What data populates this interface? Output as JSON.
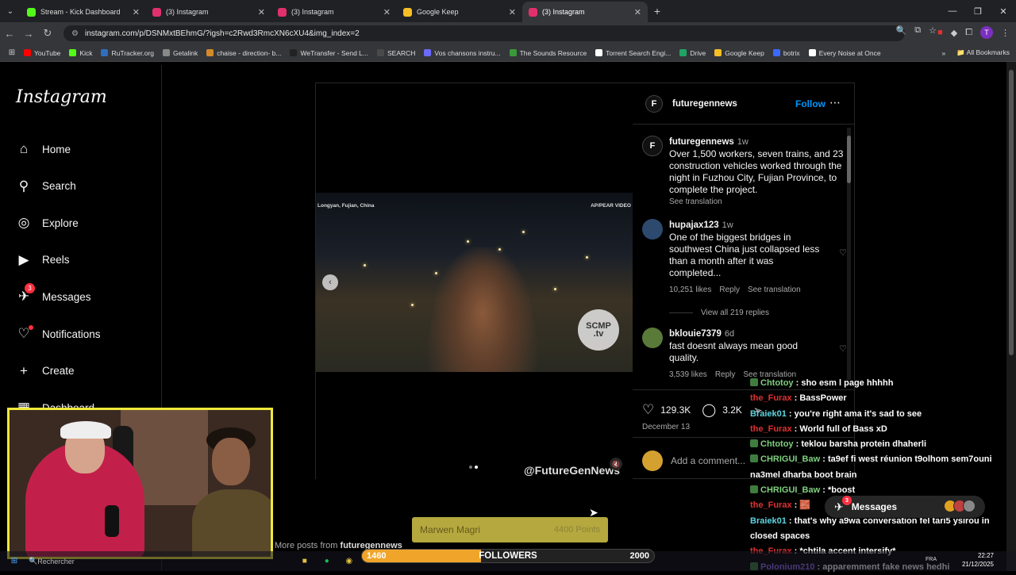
{
  "browser": {
    "tabs": [
      {
        "title": "Stream - Kick Dashboard",
        "color": "#53fc18",
        "active": false
      },
      {
        "title": "(3) Instagram",
        "color": "#e1306c",
        "active": false
      },
      {
        "title": "(3) Instagram",
        "color": "#e1306c",
        "active": false
      },
      {
        "title": "Google Keep",
        "color": "#f6bf26",
        "active": false
      },
      {
        "title": "(3) Instagram",
        "color": "#e1306c",
        "active": true
      }
    ],
    "url": "instagram.com/p/DSNMxtBEhmG/?igsh=c2Rwd3RmcXN6cXU4&img_index=2",
    "profile_initial": "T",
    "bookmarks": [
      {
        "label": "YouTube",
        "color": "#ff0000"
      },
      {
        "label": "Kick",
        "color": "#53fc18"
      },
      {
        "label": "RuTracker.org",
        "color": "#2f6fbf"
      },
      {
        "label": "Getalink",
        "color": "#888888"
      },
      {
        "label": "chaise - direction- b...",
        "color": "#d48a2a"
      },
      {
        "label": "WeTransfer - Send L...",
        "color": "#222222"
      },
      {
        "label": "SEARCH",
        "color": "#4a4a4a"
      },
      {
        "label": "Vos chansons instru...",
        "color": "#6a6aff"
      },
      {
        "label": "The Sounds Resource",
        "color": "#3a9a3a"
      },
      {
        "label": "Torrent Search Engi...",
        "color": "#ffffff"
      },
      {
        "label": "Drive",
        "color": "#1fa463"
      },
      {
        "label": "Google Keep",
        "color": "#f6bf26"
      },
      {
        "label": "botrix",
        "color": "#3a6aff"
      },
      {
        "label": "Every Noise at Once",
        "color": "#ffffff"
      }
    ],
    "all_bookmarks": "All Bookmarks"
  },
  "instagram": {
    "logo": "Instagram",
    "nav": [
      {
        "label": "Home",
        "icon": "home-icon"
      },
      {
        "label": "Search",
        "icon": "search-icon"
      },
      {
        "label": "Explore",
        "icon": "compass-icon"
      },
      {
        "label": "Reels",
        "icon": "reels-icon"
      },
      {
        "label": "Messages",
        "icon": "messenger-icon",
        "badge": "3"
      },
      {
        "label": "Notifications",
        "icon": "heart-icon"
      },
      {
        "label": "Create",
        "icon": "plus-icon"
      },
      {
        "label": "Dashboard",
        "icon": "dashboard-icon"
      }
    ],
    "post": {
      "author": "futuregennews",
      "follow": "Follow",
      "video_label_left": "Longyan, Fujian, China",
      "video_label_right": "AP/PEAR VIDEO",
      "scmp_line1": "SCMP",
      "scmp_line2": ".tv",
      "watermark": "@FutureGenNews",
      "caption": {
        "user": "futuregennews",
        "time": "1w",
        "text": "Over 1,500 workers, seven trains, and 23 construction vehicles worked through the night in Fuzhou City, Fujian Province, to complete the project.",
        "see_translation": "See translation"
      },
      "comments": [
        {
          "user": "hupajax123",
          "time": "1w",
          "text": "One of the biggest bridges in southwest China just collapsed less than a month after it was completed...",
          "likes": "10,251 likes",
          "reply": "Reply",
          "translate": "See translation",
          "view_replies": "View all 219 replies"
        },
        {
          "user": "bklouie7379",
          "time": "6d",
          "text": "fast doesnt always mean good quality.",
          "likes": "3,539 likes",
          "reply": "Reply",
          "translate": "See translation"
        }
      ],
      "like_count": "129.3K",
      "comment_count": "3.2K",
      "date": "December 13",
      "add_comment": "Add a comment...",
      "more_posts": "More posts from",
      "more_posts_user": "futuregennews"
    },
    "messages_pill": {
      "label": "Messages",
      "badge": "3"
    }
  },
  "stream_overlay": {
    "chat": [
      {
        "name": "Chtotoy",
        "color": "#7fd07f",
        "badge": true,
        "msg": "sho esm l page hhhhh"
      },
      {
        "name": "the_Furax",
        "color": "#e03030",
        "badge": false,
        "msg": "BassPower"
      },
      {
        "name": "Braiek01",
        "color": "#5fd5e0",
        "badge": false,
        "msg": "you're right ama it's sad to see"
      },
      {
        "name": "the_Furax",
        "color": "#e03030",
        "badge": false,
        "msg": "World full of Bass xD"
      },
      {
        "name": "Chtotoy",
        "color": "#7fd07f",
        "badge": true,
        "msg": "teklou barsha protein dhaherli"
      },
      {
        "name": "CHRIGUI_Baw",
        "color": "#7fd07f",
        "badge": true,
        "msg": "ta9ef fi west réunion t9olhom sem7ouni na3mel dharba boot brain"
      },
      {
        "name": "CHRIGUI_Baw",
        "color": "#7fd07f",
        "badge": true,
        "msg": "*boost"
      },
      {
        "name": "the_Furax",
        "color": "#e03030",
        "badge": false,
        "msg": "🧱"
      },
      {
        "name": "Braiek01",
        "color": "#5fd5e0",
        "badge": false,
        "msg": "that's why a9wa conversation fel tari5 ysirou in closed spaces"
      },
      {
        "name": "the_Furax",
        "color": "#e03030",
        "badge": false,
        "msg": "*chtila accent intersify*"
      },
      {
        "name": "Polonium210",
        "color": "#9b6bff",
        "badge": true,
        "msg": "apparemment fake news hedhi"
      }
    ],
    "goal": {
      "name": "Marwen Magri",
      "points": "4400 Points"
    },
    "followers_bar": {
      "min": "1460",
      "label": "FOLLOWERS",
      "max": "2000",
      "current": 1680,
      "range": [
        1460,
        2000
      ]
    }
  },
  "taskbar": {
    "search": "Rechercher",
    "lang": "FRA",
    "time": "22:27",
    "date": "21/12/2025"
  }
}
